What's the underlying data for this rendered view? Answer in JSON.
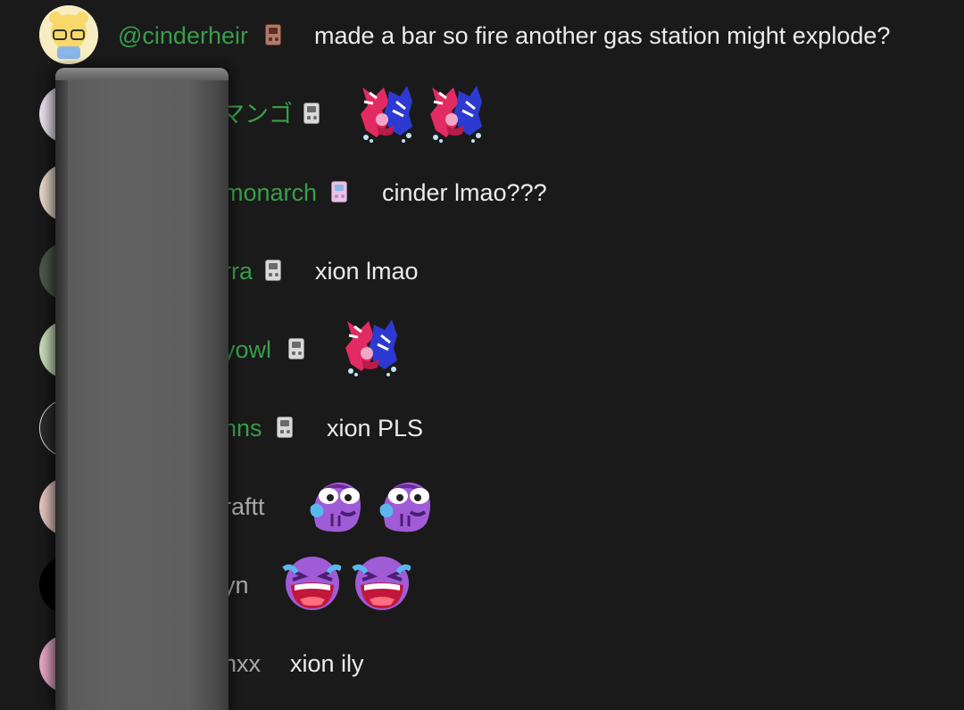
{
  "messages": [
    {
      "username": "@cinderheir",
      "text": "made a bar so fire another gas station might explode?",
      "emotes": []
    },
    {
      "username": "マンゴ",
      "text": "",
      "emotes": [
        "crying-demon-emote",
        "crying-demon-emote"
      ]
    },
    {
      "username": "monarch",
      "text": "cinder lmao???",
      "emotes": []
    },
    {
      "username": "rra",
      "text": "xion lmao",
      "emotes": []
    },
    {
      "username": "yowl",
      "text": "",
      "emotes": [
        "crying-demon-emote"
      ]
    },
    {
      "username": "nns",
      "text": "xion PLS",
      "emotes": []
    },
    {
      "username": "raftt",
      "text": "",
      "emotes": [
        "purple-teary-emote",
        "purple-teary-emote"
      ]
    },
    {
      "username": "yn",
      "text": "",
      "emotes": [
        "purple-laughing-crying-emote",
        "purple-laughing-crying-emote"
      ]
    },
    {
      "username": "nxx",
      "text": "xion ily",
      "emotes": []
    }
  ],
  "colors": {
    "background": "#1a1a1a",
    "member_name": "#3a9d4a",
    "regular_name": "#a9a9a9",
    "message_text": "#ececec",
    "overlay": "#5e5e5e"
  },
  "icons": {
    "member_badge": "gameboy-badge-icon"
  }
}
